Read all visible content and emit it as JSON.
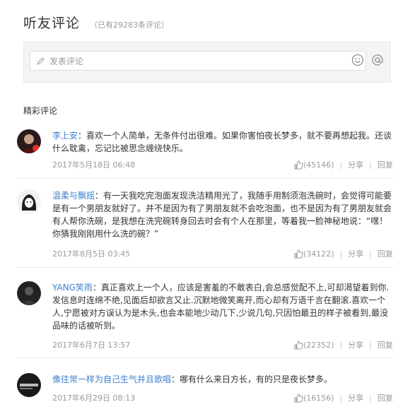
{
  "header": {
    "title": "听友评论",
    "count": "（已有29283条评论）"
  },
  "composer": {
    "placeholder": "发表评论"
  },
  "section_title": "精彩评论",
  "actions": {
    "share": "分享",
    "reply": "回复"
  },
  "comments": [
    {
      "user": "李上安",
      "sep": "：",
      "text": "喜欢一个人简单，无条件付出很难。如果你害怕夜长梦多，就不要再想起我。还谈什么耽禽，忘记比被思念缠绕快乐。",
      "date": "2017年5月18日 06:48",
      "likes": "(45146)"
    },
    {
      "user": "温柔与飘摇",
      "sep": "：",
      "text": "有一天我吃完泡面发现洗洁精用光了，我随手用制须泡洗碗时，会觉得可能要是有一个男朋友就好了。并不是因为有了男朋友就不会吃泡面，也不是因为有了男朋友就会有人帮你洗碗，是我想在洗完碗转身回去时会有个人在那里，等着我一脸神秘地说：“嘿！你猜我刚刚用什么洗的碗？”",
      "date": "2017年8月5日 03:45",
      "likes": "(34122)"
    },
    {
      "user": "YANG笑雨",
      "sep": "：",
      "text": "真正喜欢上一个人，应该是害羞的不敢表白,会总感觉配不上,可却渴望着到你.发信息时连绵不绝,见面后却欲言又止.沉默地微笑离开,而心却有万语千言在翻滚.喜欢一个人,宁愿被对方误认为是木头,也会本能地少动几下,少说几句,只因怕最丑的样子被看到,最没品味的话被听到。",
      "date": "2017年6月7日 13:57",
      "likes": "(22352)"
    },
    {
      "user": "像往常一样为自己生气并且歌唱",
      "sep": "：",
      "text": "哪有什么来日方长，有的只是夜长梦多。",
      "date": "2017年6月29日 08:13",
      "likes": "(16156)"
    }
  ]
}
